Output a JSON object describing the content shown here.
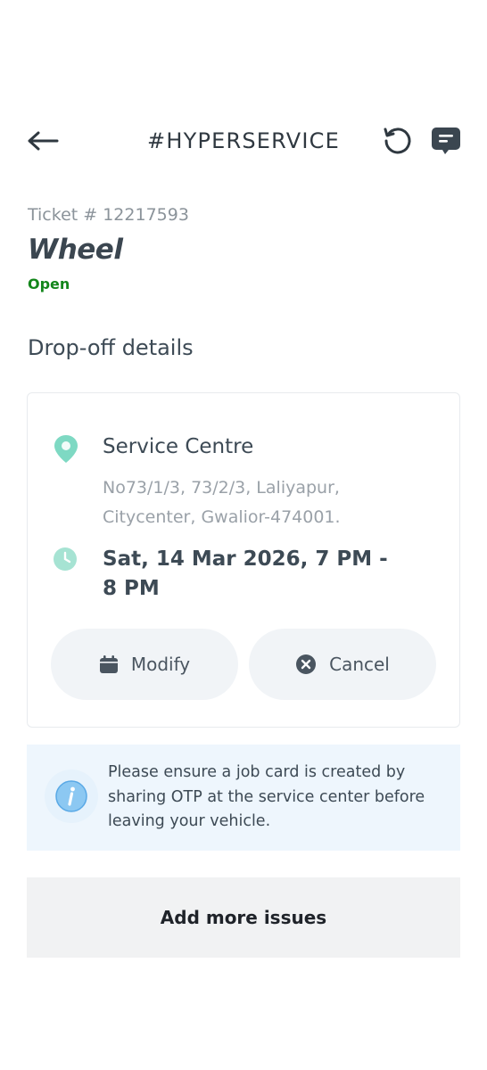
{
  "header": {
    "title": "#HYPERSERVICE"
  },
  "ticket": {
    "number_label": "Ticket # 12217593",
    "category": "Wheel",
    "status": "Open"
  },
  "dropoff": {
    "section_title": "Drop-off details",
    "location_name": "Service Centre",
    "address": "No73/1/3, 73/2/3, Laliyapur, Citycenter, Gwalior-474001.",
    "slot": "Sat, 14 Mar 2026, 7 PM - 8 PM",
    "modify_label": "Modify",
    "cancel_label": "Cancel"
  },
  "info": {
    "message": "Please ensure a job card is created by sharing OTP at the service center before leaving your vehicle."
  },
  "actions": {
    "add_issues_label": "Add more issues"
  },
  "colors": {
    "status_open": "#13861b",
    "accent_teal": "#7ed9c3",
    "info_blue": "#5aa9e6"
  },
  "icons": {
    "back": "arrow-left-icon",
    "history": "history-icon",
    "chat": "chat-icon",
    "location": "location-pin-icon",
    "time": "clock-icon",
    "modify": "calendar-icon",
    "cancel": "close-circle-icon",
    "info": "info-icon"
  }
}
